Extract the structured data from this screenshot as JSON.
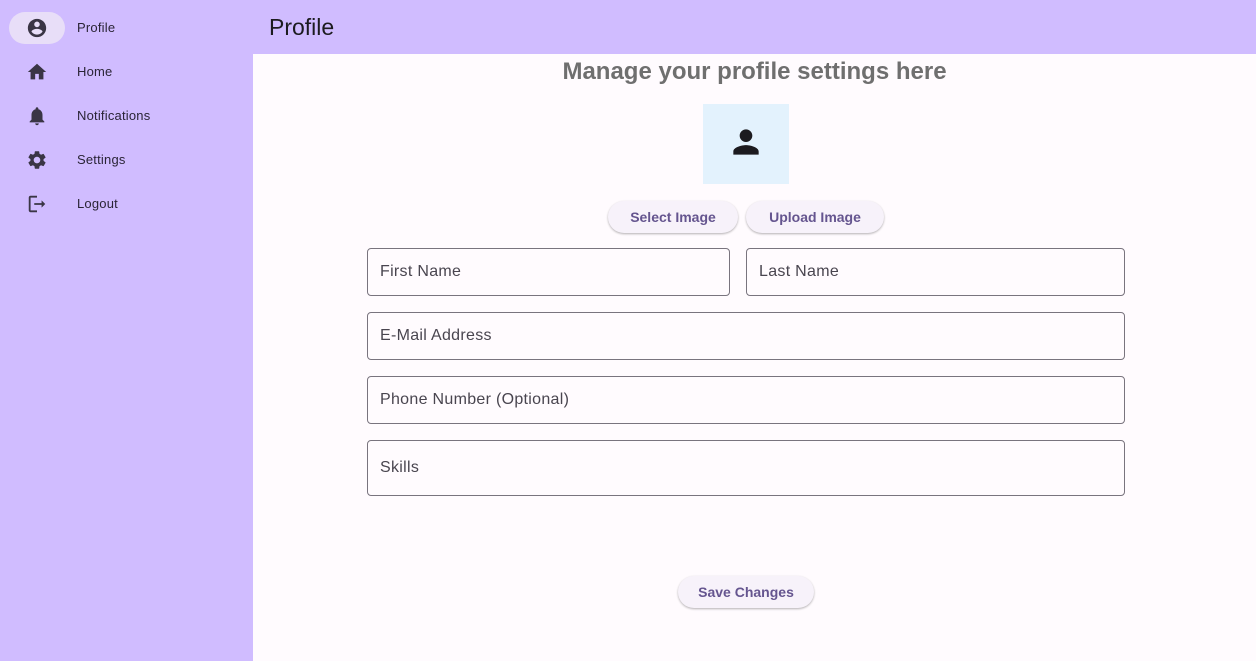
{
  "sidebar": {
    "items": [
      {
        "label": "Profile",
        "icon": "account-circle-icon",
        "active": true
      },
      {
        "label": "Home",
        "icon": "home-icon",
        "active": false
      },
      {
        "label": "Notifications",
        "icon": "bell-icon",
        "active": false
      },
      {
        "label": "Settings",
        "icon": "gear-icon",
        "active": false
      },
      {
        "label": "Logout",
        "icon": "logout-icon",
        "active": false
      }
    ]
  },
  "appbar": {
    "title": "Profile"
  },
  "main": {
    "heading": "Manage your profile settings here",
    "avatar_icon": "person-icon",
    "select_image_label": "Select Image",
    "upload_image_label": "Upload Image",
    "fields": {
      "first_name": {
        "placeholder": "First Name",
        "value": ""
      },
      "last_name": {
        "placeholder": "Last Name",
        "value": ""
      },
      "email": {
        "placeholder": "E-Mail Address",
        "value": ""
      },
      "phone": {
        "placeholder": "Phone Number (Optional)",
        "value": ""
      },
      "skills": {
        "placeholder": "Skills",
        "value": ""
      }
    },
    "save_label": "Save Changes"
  },
  "colors": {
    "sidebar_bg": "#d0bcff",
    "active_indicator": "#e8def8",
    "button_text": "#65558f",
    "avatar_bg": "#e3f2fd",
    "page_bg": "#fffbfe"
  }
}
